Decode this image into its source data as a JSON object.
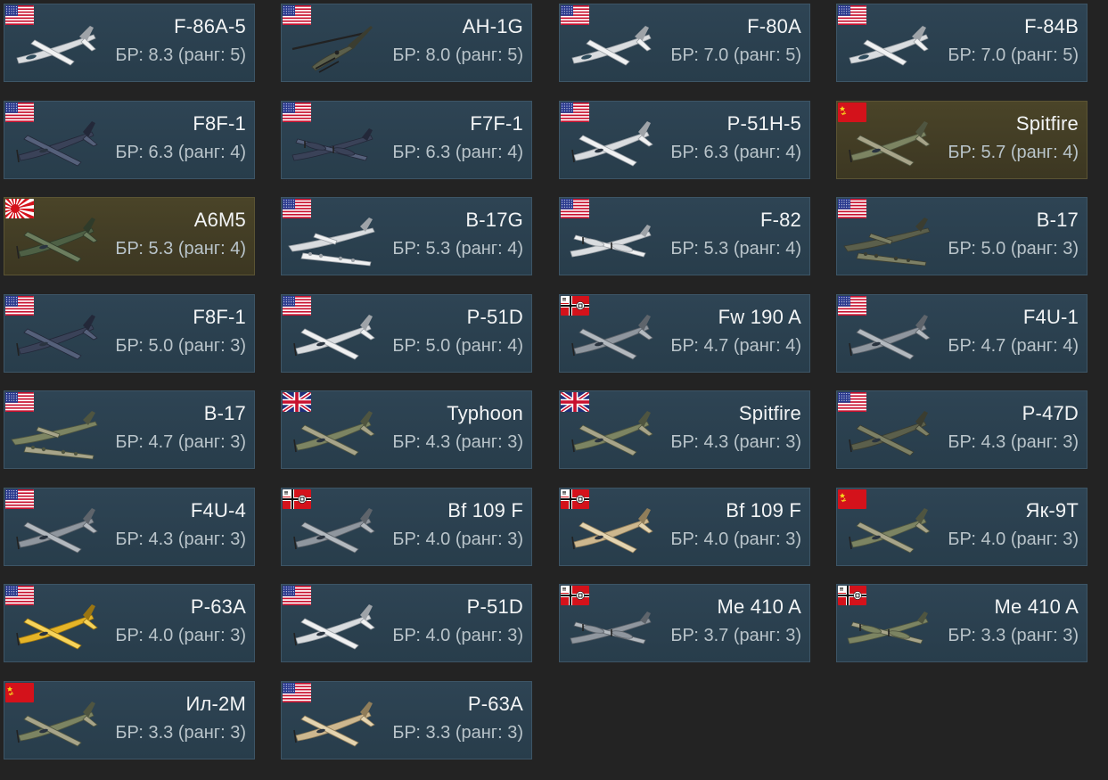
{
  "colors": {
    "background": "#232323",
    "card": "#2b4050",
    "card_premium": "#433e25",
    "name_text": "#f2f4f5",
    "br_text": "#b9c4ca"
  },
  "br_prefix": "БР:",
  "rank_word": "ранг:",
  "vehicles": [
    {
      "name": "F-86A-5",
      "br": "8.3",
      "rank": "5",
      "nation": "usa",
      "type": "jet",
      "scheme": "silver",
      "premium": false
    },
    {
      "name": "AH-1G",
      "br": "8.0",
      "rank": "5",
      "nation": "usa",
      "type": "heli",
      "scheme": "olive",
      "premium": false
    },
    {
      "name": "F-80A",
      "br": "7.0",
      "rank": "5",
      "nation": "usa",
      "type": "jet",
      "scheme": "silver",
      "premium": false
    },
    {
      "name": "F-84B",
      "br": "7.0",
      "rank": "5",
      "nation": "usa",
      "type": "jet",
      "scheme": "silver",
      "premium": false
    },
    {
      "name": "F8F-1",
      "br": "6.3",
      "rank": "4",
      "nation": "usa",
      "type": "prop",
      "scheme": "navy",
      "premium": false
    },
    {
      "name": "F7F-1",
      "br": "6.3",
      "rank": "4",
      "nation": "usa",
      "type": "twin",
      "scheme": "navy",
      "premium": false
    },
    {
      "name": "P-51H-5",
      "br": "6.3",
      "rank": "4",
      "nation": "usa",
      "type": "prop",
      "scheme": "silver",
      "premium": false
    },
    {
      "name": "Spitfire",
      "br": "5.7",
      "rank": "4",
      "nation": "ussr",
      "type": "prop",
      "scheme": "camo",
      "premium": true
    },
    {
      "name": "A6M5",
      "br": "5.3",
      "rank": "4",
      "nation": "japan",
      "type": "prop",
      "scheme": "green",
      "premium": true
    },
    {
      "name": "B-17G",
      "br": "5.3",
      "rank": "4",
      "nation": "usa",
      "type": "bomber",
      "scheme": "silver",
      "premium": false
    },
    {
      "name": "F-82",
      "br": "5.3",
      "rank": "4",
      "nation": "usa",
      "type": "twin",
      "scheme": "silver",
      "premium": false
    },
    {
      "name": "B-17",
      "br": "5.0",
      "rank": "3",
      "nation": "usa",
      "type": "bomber",
      "scheme": "olive",
      "premium": false
    },
    {
      "name": "F8F-1",
      "br": "5.0",
      "rank": "3",
      "nation": "usa",
      "type": "prop",
      "scheme": "navy",
      "premium": false
    },
    {
      "name": "P-51D",
      "br": "5.0",
      "rank": "4",
      "nation": "usa",
      "type": "prop",
      "scheme": "silver",
      "premium": false
    },
    {
      "name": "Fw 190 A",
      "br": "4.7",
      "rank": "4",
      "nation": "germany",
      "type": "prop",
      "scheme": "grey",
      "premium": false
    },
    {
      "name": "F4U-1",
      "br": "4.7",
      "rank": "4",
      "nation": "usa",
      "type": "prop",
      "scheme": "grey",
      "premium": false
    },
    {
      "name": "B-17",
      "br": "4.7",
      "rank": "3",
      "nation": "usa",
      "type": "bomber",
      "scheme": "camo",
      "premium": false
    },
    {
      "name": "Typhoon",
      "br": "4.3",
      "rank": "3",
      "nation": "uk",
      "type": "prop",
      "scheme": "camo",
      "premium": false
    },
    {
      "name": "Spitfire",
      "br": "4.3",
      "rank": "3",
      "nation": "uk",
      "type": "prop",
      "scheme": "camo",
      "premium": false
    },
    {
      "name": "P-47D",
      "br": "4.3",
      "rank": "3",
      "nation": "usa",
      "type": "prop",
      "scheme": "olive",
      "premium": false
    },
    {
      "name": "F4U-4",
      "br": "4.3",
      "rank": "3",
      "nation": "usa",
      "type": "prop",
      "scheme": "grey",
      "premium": false
    },
    {
      "name": "Bf 109 F",
      "br": "4.0",
      "rank": "3",
      "nation": "germany",
      "type": "prop",
      "scheme": "grey",
      "premium": false
    },
    {
      "name": "Bf 109 F",
      "br": "4.0",
      "rank": "3",
      "nation": "germany",
      "type": "prop",
      "scheme": "tan",
      "premium": false
    },
    {
      "name": "Як-9Т",
      "br": "4.0",
      "rank": "3",
      "nation": "ussr",
      "type": "prop",
      "scheme": "camo",
      "premium": false
    },
    {
      "name": "P-63A",
      "br": "4.0",
      "rank": "3",
      "nation": "usa",
      "type": "prop",
      "scheme": "yellow",
      "premium": false
    },
    {
      "name": "P-51D",
      "br": "4.0",
      "rank": "3",
      "nation": "usa",
      "type": "prop",
      "scheme": "silver",
      "premium": false
    },
    {
      "name": "Me 410 A",
      "br": "3.7",
      "rank": "3",
      "nation": "germany",
      "type": "twin",
      "scheme": "grey",
      "premium": false
    },
    {
      "name": "Me 410 A",
      "br": "3.3",
      "rank": "3",
      "nation": "germany",
      "type": "twin",
      "scheme": "camo",
      "premium": false
    },
    {
      "name": "Ил-2М",
      "br": "3.3",
      "rank": "3",
      "nation": "ussr",
      "type": "prop",
      "scheme": "camo",
      "premium": false
    },
    {
      "name": "P-63A",
      "br": "3.3",
      "rank": "3",
      "nation": "usa",
      "type": "prop",
      "scheme": "tan",
      "premium": false
    }
  ]
}
